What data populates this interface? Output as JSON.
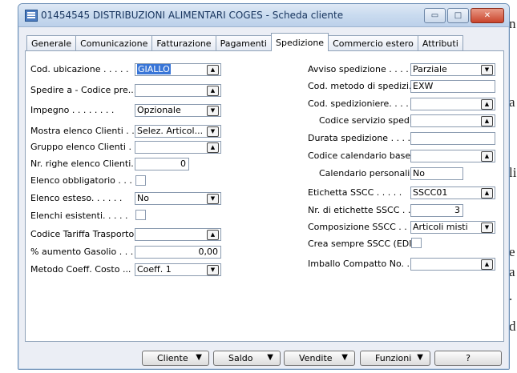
{
  "background_text": [
    "n",
    "a",
    "li",
    "e",
    "a",
    ".",
    "d"
  ],
  "window": {
    "title": "01454545 DISTRIBUZIONI ALIMENTARI COGES - Scheda cliente",
    "controls": {
      "minimize": "▭",
      "maximize": "□",
      "close": "✕"
    }
  },
  "tabs": [
    "Generale",
    "Comunicazione",
    "Fatturazione",
    "Pagamenti",
    "Spedizione",
    "Commercio estero",
    "Attributi"
  ],
  "active_tab": "Spedizione",
  "left": {
    "cod_ubicazione": {
      "label": "Cod. ubicazione . . . . .",
      "value": "GIALLO"
    },
    "spedire_a": {
      "label": "Spedire a - Codice pre...",
      "value": ""
    },
    "impegno": {
      "label": "Impegno . . . . . . . .",
      "value": "Opzionale"
    },
    "mostra_elenco": {
      "label": "Mostra elenco Clienti . .",
      "value": "Selez. Articol..."
    },
    "gruppo_elenco": {
      "label": "Gruppo elenco Clienti . .",
      "value": ""
    },
    "nr_righe": {
      "label": "Nr. righe elenco Clienti. .",
      "value": "0"
    },
    "elenco_obbligatorio": {
      "label": "Elenco obbligatorio . . .",
      "checked": false
    },
    "elenco_esteso": {
      "label": "Elenco esteso. . . . . .",
      "value": "No"
    },
    "elenchi_esistenti": {
      "label": "Elenchi esistenti. . . . .",
      "checked": false
    },
    "codice_tariffa": {
      "label": "Codice Tariffa Trasporto.",
      "value": ""
    },
    "aumento_gasolio": {
      "label": "% aumento Gasolio . . .",
      "value": "0,00"
    },
    "metodo_coeff": {
      "label": "Metodo Coeff. Costo ...",
      "value": "Coeff. 1"
    }
  },
  "right": {
    "avviso": {
      "label": "Avviso spedizione . . . .",
      "value": "Parziale"
    },
    "cod_metodo": {
      "label": "Cod. metodo di spedizi...",
      "value": "EXW"
    },
    "cod_spedizioniere": {
      "label": "Cod. spedizioniere. . . .",
      "value": ""
    },
    "codice_servizio": {
      "label": "Codice servizio spedi...",
      "value": ""
    },
    "durata": {
      "label": "Durata spedizione . . . .",
      "value": ""
    },
    "codice_calendario": {
      "label": "Codice calendario base .",
      "value": ""
    },
    "calendario_pers": {
      "label": "Calendario personali...",
      "value": "No"
    },
    "etichetta_sscc": {
      "label": "Etichetta SSCC . . . . .",
      "value": "SSCC01"
    },
    "nr_etichette": {
      "label": "Nr. di etichette SSCC . .",
      "value": "3"
    },
    "composizione": {
      "label": "Composizione SSCC . . .",
      "value": "Articoli misti"
    },
    "crea_sempre": {
      "label": "Crea sempre SSCC (EDI).",
      "checked": false
    },
    "imballo": {
      "label": "Imballo Compatto No. . .",
      "value": ""
    }
  },
  "buttons": {
    "cliente": "Cliente",
    "saldo": "Saldo",
    "vendite": "Vendite",
    "funzioni": "Funzioni",
    "help": "?"
  }
}
